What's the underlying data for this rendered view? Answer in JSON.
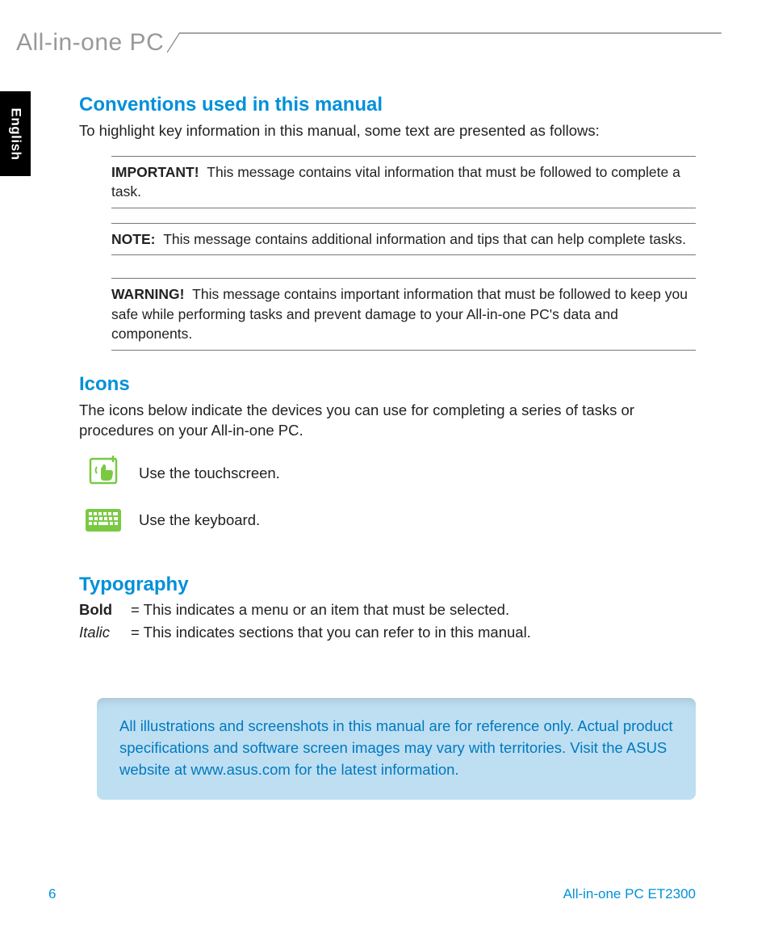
{
  "header": {
    "title": "All-in-one PC"
  },
  "lang_tab": "English",
  "sections": {
    "conventions": {
      "heading": "Conventions used in this manual",
      "intro": "To highlight key information in this manual, some text are presented as follows:",
      "important": {
        "lead": "IMPORTANT!",
        "text": "This message contains vital information that must be followed to complete a task."
      },
      "note": {
        "lead": "NOTE:",
        "text": "This message contains additional information and tips that can help complete tasks."
      },
      "warning": {
        "lead": "WARNING!",
        "text": "This message contains important information that must be followed to keep you safe while performing tasks and prevent damage to your All-in-one PC's data and components."
      }
    },
    "icons": {
      "heading": "Icons",
      "intro": "The icons below indicate the devices you can use for completing a series of tasks or procedures on your All-in-one PC.",
      "items": [
        {
          "name": "touchscreen-icon",
          "label": "Use the touchscreen."
        },
        {
          "name": "keyboard-icon",
          "label": "Use the keyboard."
        }
      ]
    },
    "typography": {
      "heading": "Typography",
      "rows": [
        {
          "term": "Bold",
          "desc": "= This indicates a menu or an item that must be selected."
        },
        {
          "term": "Italic",
          "desc": "= This indicates sections that you can refer to in this manual."
        }
      ]
    },
    "reference_note": "All illustrations and screenshots in this manual are for reference only. Actual product specifications and software screen images may vary with territories. Visit the ASUS website at www.asus.com for the latest information."
  },
  "footer": {
    "page": "6",
    "model": "All-in-one PC ET2300"
  },
  "colors": {
    "accent": "#0090d9",
    "icon_green": "#7ac943",
    "note_bg": "#bedff2"
  }
}
